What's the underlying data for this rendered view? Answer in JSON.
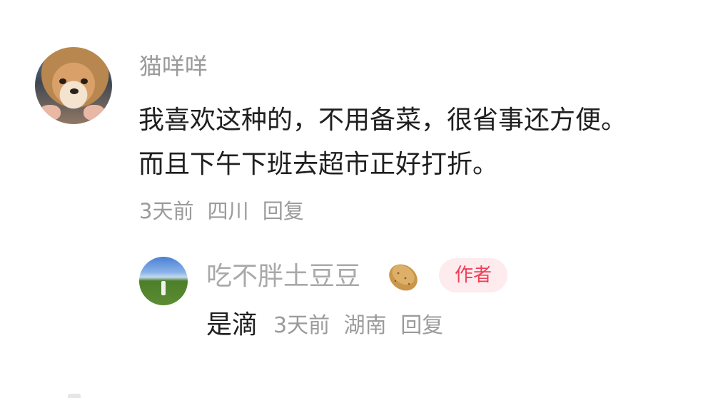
{
  "comment": {
    "username": "猫咩咩",
    "text_line1": "我喜欢这种的，不用备菜，很省事还方便。",
    "text_line2": "而且下午下班去超市正好打折。",
    "time": "3天前",
    "location": "四川",
    "reply_label": "回复"
  },
  "reply": {
    "username": "吃不胖土豆豆",
    "badge": "作者",
    "text": "是滴",
    "time": "3天前",
    "location": "湖南",
    "reply_label": "回复",
    "emoji": "potato-icon"
  },
  "colors": {
    "username": "#9a9a9a",
    "author_badge_text": "#ef3e57",
    "author_badge_bg": "#fdebed"
  }
}
